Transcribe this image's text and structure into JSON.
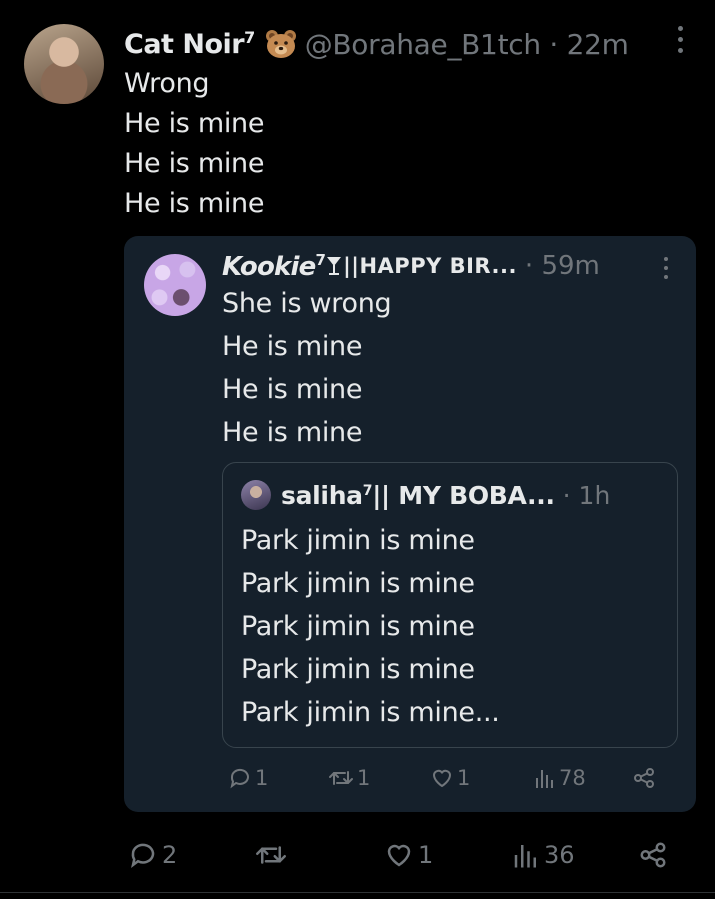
{
  "main_tweet": {
    "author_name": "Cat Noir",
    "author_superscript": "7",
    "author_emoji_icon": "bear-face-icon",
    "handle": "@Borahae_B1tch",
    "separator": "·",
    "time": "22m",
    "lines": [
      "Wrong",
      "He is mine",
      "He is mine",
      "He is mine"
    ],
    "actions": {
      "reply_count": "2",
      "retweet_count": "",
      "like_count": "1",
      "views_count": "36"
    }
  },
  "quote_tweet": {
    "author_name": "Kookie",
    "author_superscript": "7",
    "author_name_suffix": "||HAPPY BIR...",
    "time": "· 59m",
    "lines": [
      "She is wrong",
      "He is mine",
      "He is mine",
      "He is mine"
    ],
    "actions": {
      "reply_count": "1",
      "retweet_count": "1",
      "like_count": "1",
      "views_count": "78"
    }
  },
  "nested_quote": {
    "author_name": "saliha",
    "author_superscript": "7",
    "author_name_suffix": "|| MY BOBA...",
    "time": "· 1h",
    "lines": [
      "Park jimin is mine",
      "Park jimin is mine",
      "Park jimin is mine",
      "Park jimin is mine",
      "Park jimin is mine..."
    ]
  },
  "colors": {
    "background": "#000000",
    "card": "#15202b",
    "text": "#e7e9ea",
    "muted": "#71767b"
  }
}
